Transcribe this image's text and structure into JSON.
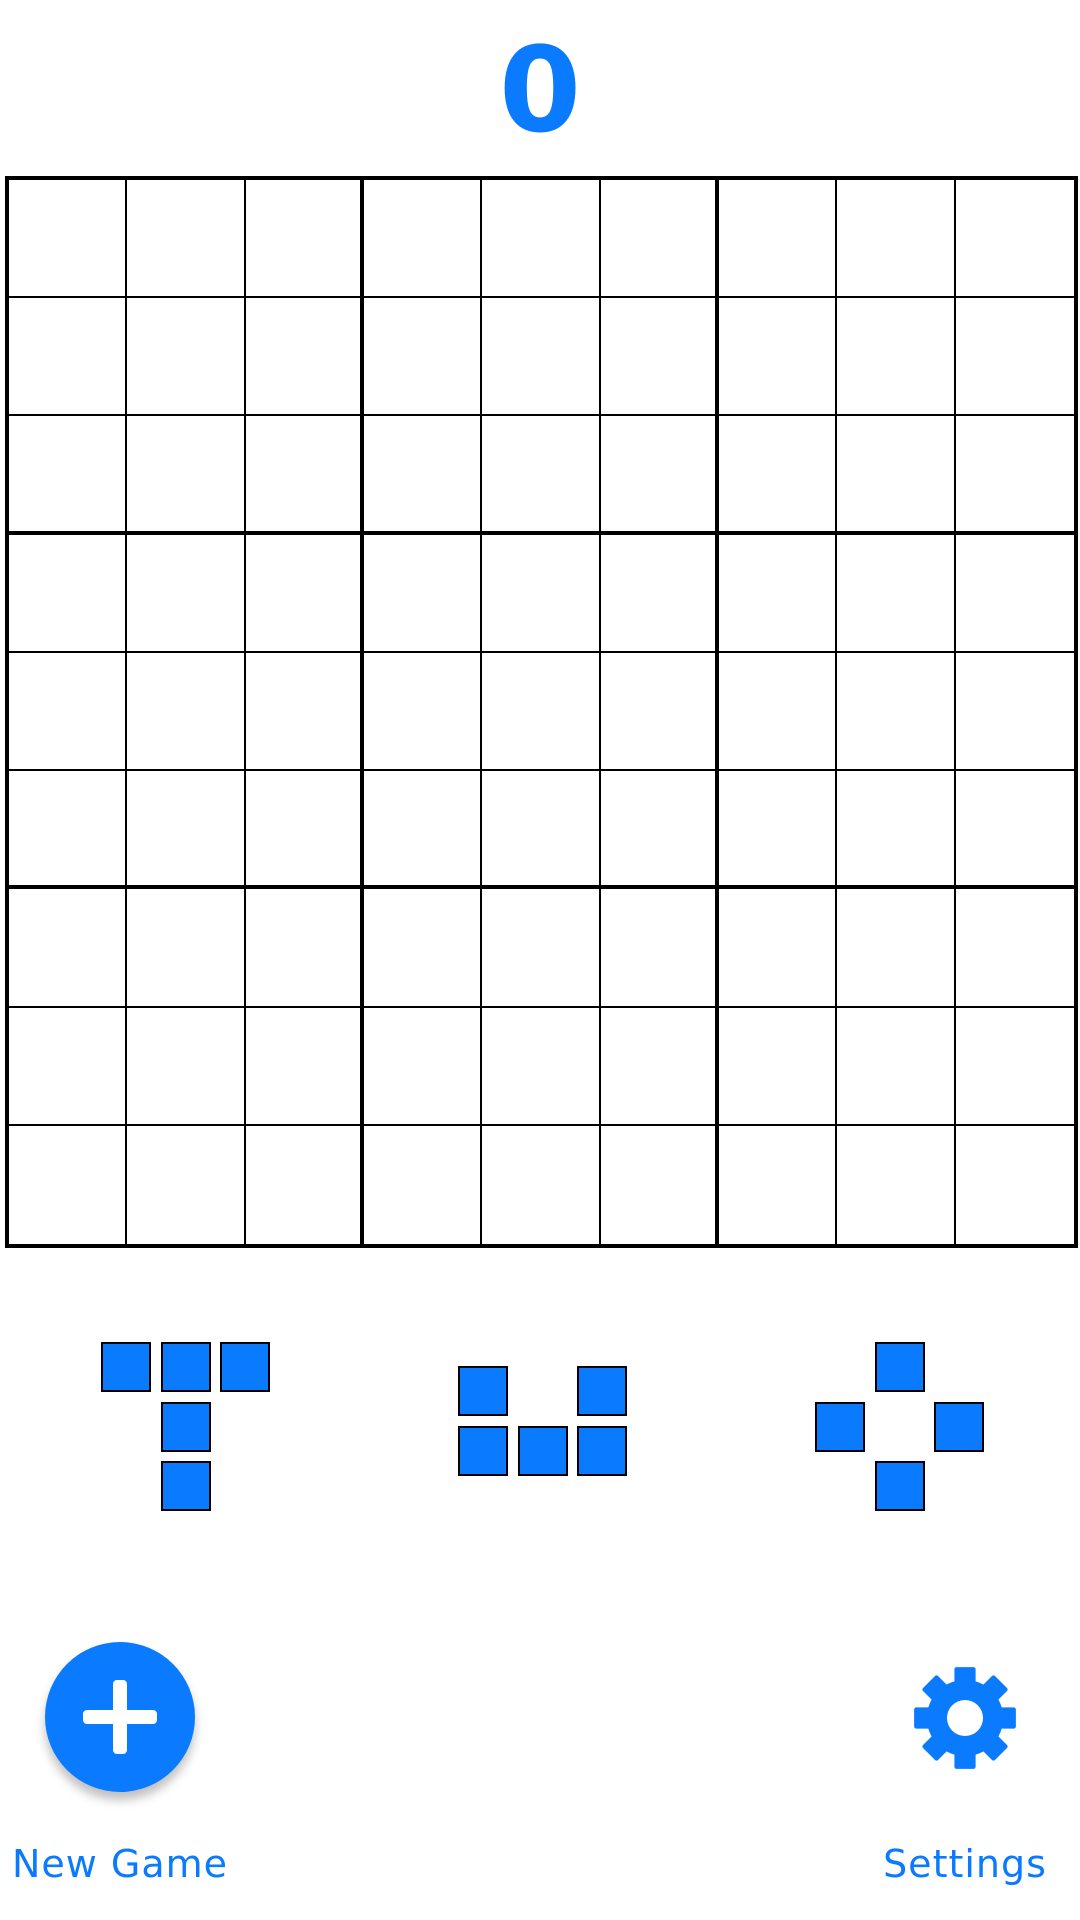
{
  "score": "0",
  "board": {
    "rows": 9,
    "cols": 9,
    "filled_cells": []
  },
  "pieces": [
    {
      "name": "t-piece-long",
      "cells": [
        [
          0,
          0
        ],
        [
          0,
          1
        ],
        [
          0,
          2
        ],
        [
          1,
          1
        ],
        [
          2,
          1
        ]
      ]
    },
    {
      "name": "u-piece",
      "cells": [
        [
          0,
          0
        ],
        [
          0,
          2
        ],
        [
          1,
          0
        ],
        [
          1,
          1
        ],
        [
          1,
          2
        ]
      ]
    },
    {
      "name": "diamond-piece",
      "cells": [
        [
          0,
          1
        ],
        [
          1,
          0
        ],
        [
          1,
          2
        ],
        [
          2,
          1
        ]
      ]
    }
  ],
  "buttons": {
    "new_game": {
      "label": "New Game",
      "icon": "plus-icon"
    },
    "settings": {
      "label": "Settings",
      "icon": "gear-icon"
    }
  },
  "colors": {
    "accent": "#0A7BFF",
    "grid": "#000000"
  }
}
